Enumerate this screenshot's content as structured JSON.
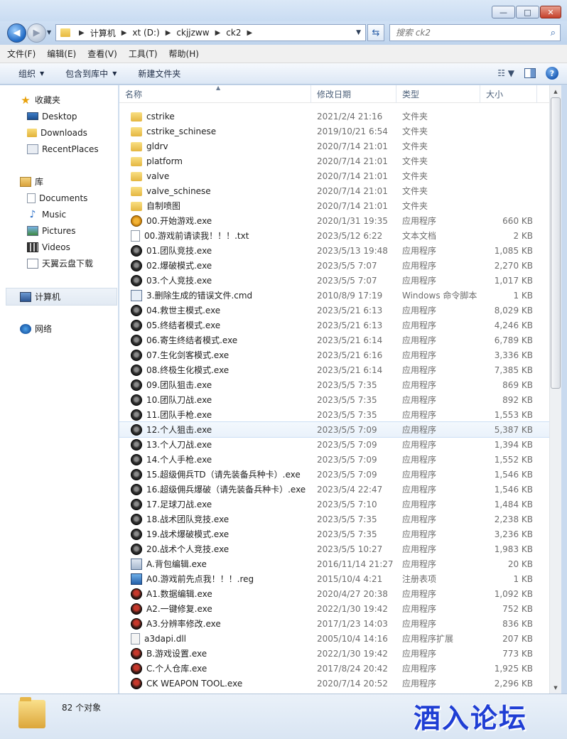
{
  "address": {
    "crumbs": [
      "计算机",
      "xt (D:)",
      "ckjjzww",
      "ck2"
    ]
  },
  "search": {
    "placeholder": "搜索 ck2"
  },
  "menu": [
    "文件(F)",
    "编辑(E)",
    "查看(V)",
    "工具(T)",
    "帮助(H)"
  ],
  "toolbar": {
    "organize": "组织",
    "include": "包含到库中",
    "newfolder": "新建文件夹"
  },
  "nav": {
    "favorites": {
      "label": "收藏夹",
      "items": [
        "Desktop",
        "Downloads",
        "RecentPlaces"
      ]
    },
    "libraries": {
      "label": "库",
      "items": [
        "Documents",
        "Music",
        "Pictures",
        "Videos",
        "天翼云盘下载"
      ]
    },
    "computer": "计算机",
    "network": "网络"
  },
  "columns": {
    "name": "名称",
    "date": "修改日期",
    "type": "类型",
    "size": "大小"
  },
  "files": [
    {
      "name": "cstrike",
      "date": "2021/2/4 21:16",
      "type": "文件夹",
      "size": "",
      "icon": "folder"
    },
    {
      "name": "cstrike_schinese",
      "date": "2019/10/21 6:54",
      "type": "文件夹",
      "size": "",
      "icon": "folder"
    },
    {
      "name": "gldrv",
      "date": "2020/7/14 21:01",
      "type": "文件夹",
      "size": "",
      "icon": "folder"
    },
    {
      "name": "platform",
      "date": "2020/7/14 21:01",
      "type": "文件夹",
      "size": "",
      "icon": "folder"
    },
    {
      "name": "valve",
      "date": "2020/7/14 21:01",
      "type": "文件夹",
      "size": "",
      "icon": "folder"
    },
    {
      "name": "valve_schinese",
      "date": "2020/7/14 21:01",
      "type": "文件夹",
      "size": "",
      "icon": "folder"
    },
    {
      "name": "自制喷图",
      "date": "2020/7/14 21:01",
      "type": "文件夹",
      "size": "",
      "icon": "folder"
    },
    {
      "name": "00.开始游戏.exe",
      "date": "2020/1/31 19:35",
      "type": "应用程序",
      "size": "660 KB",
      "icon": "exe0"
    },
    {
      "name": "00.游戏前请读我！！！.txt",
      "date": "2023/5/12 6:22",
      "type": "文本文档",
      "size": "2 KB",
      "icon": "txt"
    },
    {
      "name": "01.团队竞技.exe",
      "date": "2023/5/13 19:48",
      "type": "应用程序",
      "size": "1,085 KB",
      "icon": "exe"
    },
    {
      "name": "02.爆破模式.exe",
      "date": "2023/5/5 7:07",
      "type": "应用程序",
      "size": "2,270 KB",
      "icon": "exe"
    },
    {
      "name": "03.个人竞技.exe",
      "date": "2023/5/5 7:07",
      "type": "应用程序",
      "size": "1,017 KB",
      "icon": "exe"
    },
    {
      "name": "3.删除生成的错误文件.cmd",
      "date": "2010/8/9 17:19",
      "type": "Windows 命令脚本",
      "size": "1 KB",
      "icon": "cmd"
    },
    {
      "name": "04.救世主模式.exe",
      "date": "2023/5/21 6:13",
      "type": "应用程序",
      "size": "8,029 KB",
      "icon": "exe"
    },
    {
      "name": "05.终结者模式.exe",
      "date": "2023/5/21 6:13",
      "type": "应用程序",
      "size": "4,246 KB",
      "icon": "exe"
    },
    {
      "name": "06.寄生终结者模式.exe",
      "date": "2023/5/21 6:14",
      "type": "应用程序",
      "size": "6,789 KB",
      "icon": "exe"
    },
    {
      "name": "07.生化剑客模式.exe",
      "date": "2023/5/21 6:16",
      "type": "应用程序",
      "size": "3,336 KB",
      "icon": "exe"
    },
    {
      "name": "08.终极生化模式.exe",
      "date": "2023/5/21 6:14",
      "type": "应用程序",
      "size": "7,385 KB",
      "icon": "exe"
    },
    {
      "name": "09.团队狙击.exe",
      "date": "2023/5/5 7:35",
      "type": "应用程序",
      "size": "869 KB",
      "icon": "exe"
    },
    {
      "name": "10.团队刀战.exe",
      "date": "2023/5/5 7:35",
      "type": "应用程序",
      "size": "892 KB",
      "icon": "exe"
    },
    {
      "name": "11.团队手枪.exe",
      "date": "2023/5/5 7:35",
      "type": "应用程序",
      "size": "1,553 KB",
      "icon": "exe"
    },
    {
      "name": "12.个人狙击.exe",
      "date": "2023/5/5 7:09",
      "type": "应用程序",
      "size": "5,387 KB",
      "icon": "exe",
      "selected": true
    },
    {
      "name": "13.个人刀战.exe",
      "date": "2023/5/5 7:09",
      "type": "应用程序",
      "size": "1,394 KB",
      "icon": "exe"
    },
    {
      "name": "14.个人手枪.exe",
      "date": "2023/5/5 7:09",
      "type": "应用程序",
      "size": "1,552 KB",
      "icon": "exe"
    },
    {
      "name": "15.超级佣兵TD（请先装备兵种卡）.exe",
      "date": "2023/5/5 7:09",
      "type": "应用程序",
      "size": "1,546 KB",
      "icon": "exe"
    },
    {
      "name": "16.超级佣兵爆破（请先装备兵种卡）.exe",
      "date": "2023/5/4 22:47",
      "type": "应用程序",
      "size": "1,546 KB",
      "icon": "exe"
    },
    {
      "name": "17.足球刀战.exe",
      "date": "2023/5/5 7:10",
      "type": "应用程序",
      "size": "1,484 KB",
      "icon": "exe"
    },
    {
      "name": "18.战术团队竞技.exe",
      "date": "2023/5/5 7:35",
      "type": "应用程序",
      "size": "2,238 KB",
      "icon": "exe"
    },
    {
      "name": "19.战术爆破模式.exe",
      "date": "2023/5/5 7:35",
      "type": "应用程序",
      "size": "3,236 KB",
      "icon": "exe"
    },
    {
      "name": "20.战术个人竞技.exe",
      "date": "2023/5/5 10:27",
      "type": "应用程序",
      "size": "1,983 KB",
      "icon": "exe"
    },
    {
      "name": "A.背包编辑.exe",
      "date": "2016/11/14 21:27",
      "type": "应用程序",
      "size": "20 KB",
      "icon": "app"
    },
    {
      "name": "A0.游戏前先点我！！！.reg",
      "date": "2015/10/4 4:21",
      "type": "注册表项",
      "size": "1 KB",
      "icon": "reg"
    },
    {
      "name": "A1.数据编辑.exe",
      "date": "2020/4/27 20:38",
      "type": "应用程序",
      "size": "1,092 KB",
      "icon": "ck"
    },
    {
      "name": "A2.一键修复.exe",
      "date": "2022/1/30 19:42",
      "type": "应用程序",
      "size": "752 KB",
      "icon": "ck"
    },
    {
      "name": "A3.分辨率修改.exe",
      "date": "2017/1/23 14:03",
      "type": "应用程序",
      "size": "836 KB",
      "icon": "ck"
    },
    {
      "name": "a3dapi.dll",
      "date": "2005/10/4 14:16",
      "type": "应用程序扩展",
      "size": "207 KB",
      "icon": "dll"
    },
    {
      "name": "B.游戏设置.exe",
      "date": "2022/1/30 19:42",
      "type": "应用程序",
      "size": "773 KB",
      "icon": "ck"
    },
    {
      "name": "C.个人仓库.exe",
      "date": "2017/8/24 20:42",
      "type": "应用程序",
      "size": "1,925 KB",
      "icon": "ck"
    },
    {
      "name": "CK WEAPON TOOL.exe",
      "date": "2020/7/14 20:52",
      "type": "应用程序",
      "size": "2,296 KB",
      "icon": "ck"
    }
  ],
  "status": {
    "count": "82 个对象"
  },
  "watermark": "酒入论坛"
}
